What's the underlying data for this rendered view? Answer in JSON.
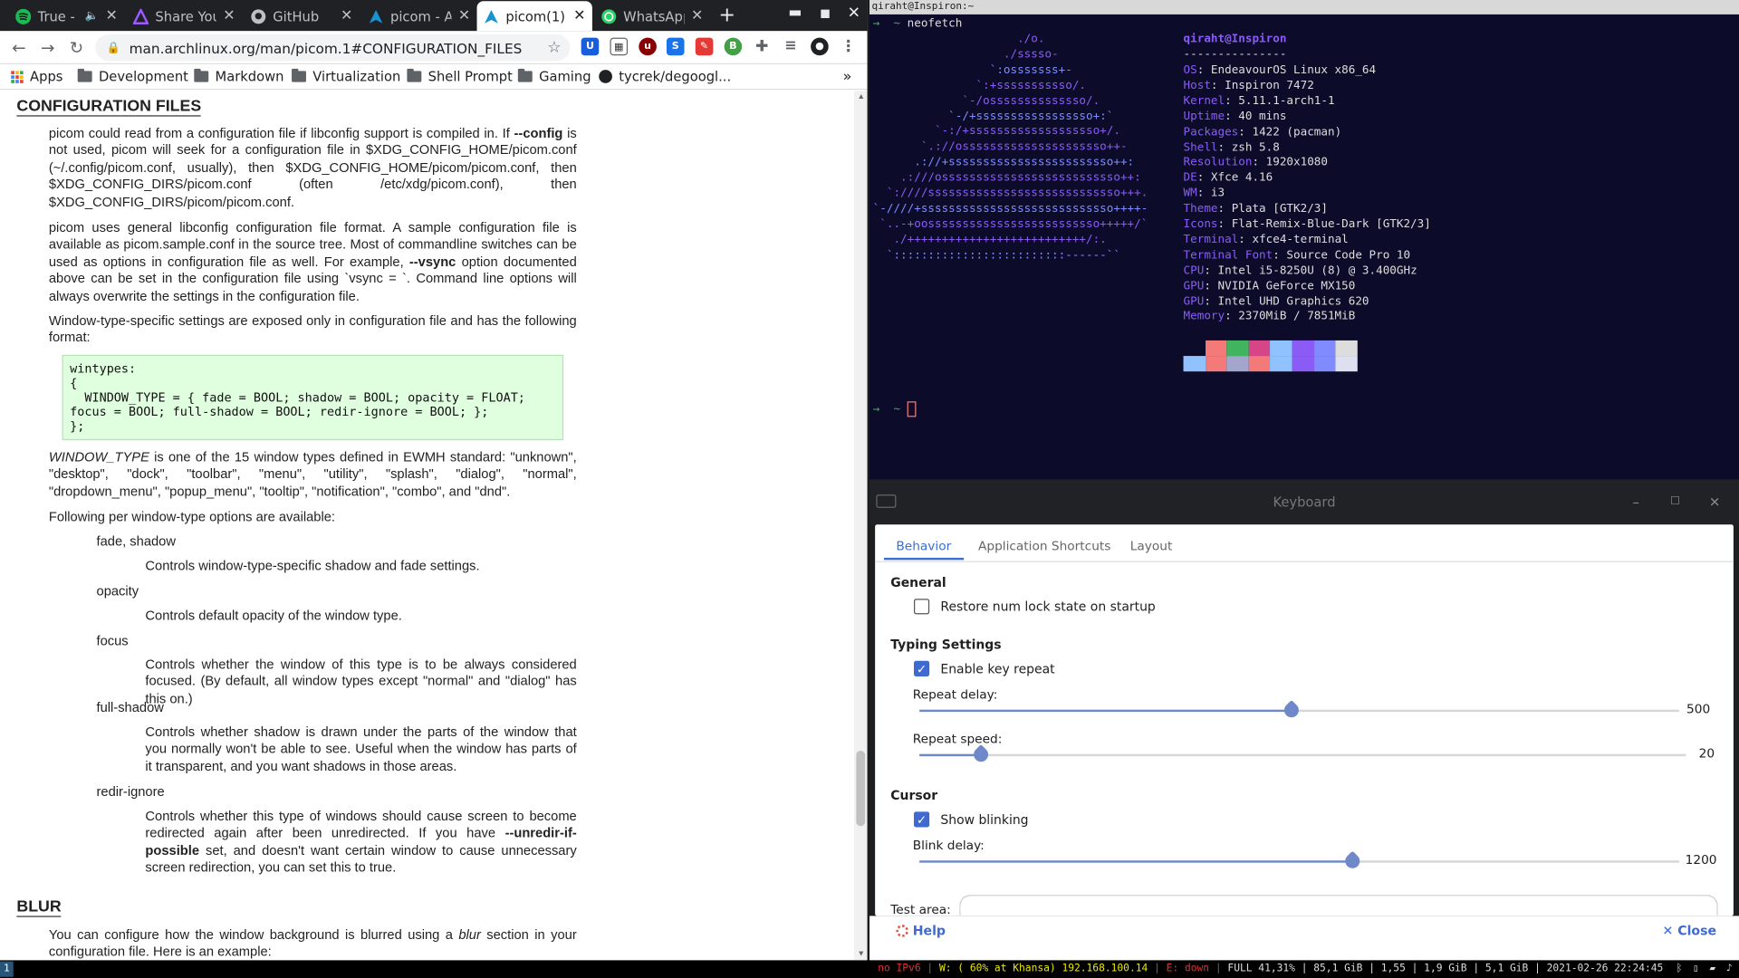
{
  "browser": {
    "tabs": [
      {
        "label": "True -",
        "icon": "spotify-icon",
        "color": "#1db954"
      },
      {
        "label": "Share You",
        "icon": "triangle-icon",
        "color": "#9b59ff"
      },
      {
        "label": "GitHub",
        "icon": "github-icon",
        "color": "#bdc1c6"
      },
      {
        "label": "picom - A",
        "icon": "arch-icon",
        "color": "#1793d1"
      },
      {
        "label": "picom(1)",
        "icon": "arch-icon",
        "color": "#1793d1"
      },
      {
        "label": "WhatsApp",
        "icon": "whatsapp-icon",
        "color": "#25d366"
      }
    ],
    "new_tab": "+",
    "url": "man.archlinux.org/man/picom.1#CONFIGURATION_FILES",
    "bookmarks": [
      "Apps",
      "Development",
      "Markdown",
      "Virtualization",
      "Shell Prompt",
      "Gaming",
      "tycrek/degoogl..."
    ],
    "bookmarks_more": "»"
  },
  "manpage": {
    "h_config": "CONFIGURATION FILES",
    "p1_a": "picom could read from a configuration file if libconfig support is compiled in. If ",
    "p1_b": "--config",
    "p1_c": " is not used, picom will seek for a configuration file in $XDG_CONFIG_HOME/picom.conf (~/.config/picom.conf, usually), then $XDG_CONFIG_HOME/picom/picom.conf, then $XDG_CONFIG_DIRS/picom.conf (often /etc/xdg/picom.conf), then $XDG_CONFIG_DIRS/picom/picom.conf.",
    "p2_a": "picom uses general libconfig configuration file format. A sample configuration file is available as picom.sample.conf in the source tree. Most of commandline switches can be used as options in configuration file as well. For example, ",
    "p2_b": "--vsync",
    "p2_c": " option documented above can be set in the configuration file using `vsync = `. Command line options will always overwrite the settings in the configuration file.",
    "p3": "Window-type-specific settings are exposed only in configuration file and has the following format:",
    "code": "wintypes:\n{\n  WINDOW_TYPE = { fade = BOOL; shadow = BOOL; opacity = FLOAT;\nfocus = BOOL; full-shadow = BOOL; redir-ignore = BOOL; };\n};",
    "p4_a": "WINDOW_TYPE",
    "p4_b": " is one of the 15 window types defined in EWMH standard: \"unknown\", \"desktop\", \"dock\", \"toolbar\", \"menu\", \"utility\", \"splash\", \"dialog\", \"normal\", \"dropdown_menu\", \"popup_menu\", \"tooltip\", \"notification\", \"combo\", and \"dnd\".",
    "p5": "Following per window-type options are available:",
    "opts": [
      {
        "term": "fade, shadow",
        "def": "Controls window-type-specific shadow and fade settings."
      },
      {
        "term": "opacity",
        "def": "Controls default opacity of the window type."
      },
      {
        "term": "focus",
        "def": "Controls whether the window of this type is to be always considered focused. (By default, all window types except \"normal\" and \"dialog\" has this on.)"
      },
      {
        "term": "full-shadow",
        "def": "Controls whether shadow is drawn under the parts of the window that you normally won't be able to see. Useful when the window has parts of it transparent, and you want shadows in those areas."
      }
    ],
    "redir_term": "redir-ignore",
    "redir_a": "Controls whether this type of windows should cause screen to become redirected again after been unredirected. If you have ",
    "redir_b": "--unredir-if-possible",
    "redir_c": " set, and doesn't want certain window to cause unnecessary screen redirection, you can set this to true.",
    "h_blur": "BLUR",
    "blur_a": "You can configure how the window background is blurred using a ",
    "blur_b": "blur",
    "blur_c": " section in your configuration file. Here is an example:"
  },
  "terminal": {
    "title": "qiraht@Inspiron:~",
    "prompt": "→  ~ ",
    "command": "neofetch",
    "logo": [
      "                     ./o.",
      "                   ./sssso-",
      "                 `:osssssss+-",
      "               `:+sssssssssso/.",
      "             `-/ossssssssssssso/.",
      "           `-/+sssssssssssssssso+:`",
      "         `-:/+sssssssssssssssssso+/.",
      "       `.://osssssssssssssssssssso++-",
      "      .://+ssssssssssssssssssssssso++:",
      "    .:///ossssssssssssssssssssssssso++:",
      "  `:////ssssssssssssssssssssssssssso+++.",
      "`-////+ssssssssssssssssssssssssssso++++-",
      " `..-+oosssssssssssssssssssssssso+++++/`",
      "   ./++++++++++++++++++++++++++/:.",
      "  `:::::::::::::::::::::::::------``"
    ],
    "user": "qiraht@Inspiron",
    "sep": "---------------",
    "info": [
      {
        "k": "OS",
        "v": "EndeavourOS Linux x86_64"
      },
      {
        "k": "Host",
        "v": "Inspiron 7472"
      },
      {
        "k": "Kernel",
        "v": "5.11.1-arch1-1"
      },
      {
        "k": "Uptime",
        "v": "40 mins"
      },
      {
        "k": "Packages",
        "v": "1422 (pacman)"
      },
      {
        "k": "Shell",
        "v": "zsh 5.8"
      },
      {
        "k": "Resolution",
        "v": "1920x1080"
      },
      {
        "k": "DE",
        "v": "Xfce 4.16"
      },
      {
        "k": "WM",
        "v": "i3"
      },
      {
        "k": "Theme",
        "v": "Plata [GTK2/3]"
      },
      {
        "k": "Icons",
        "v": "Flat-Remix-Blue-Dark [GTK2/3]"
      },
      {
        "k": "Terminal",
        "v": "xfce4-terminal"
      },
      {
        "k": "Terminal Font",
        "v": "Source Code Pro 10"
      },
      {
        "k": "CPU",
        "v": "Intel i5-8250U (8) @ 3.400GHz"
      },
      {
        "k": "GPU",
        "v": "NVIDIA GeForce MX150"
      },
      {
        "k": "GPU",
        "v": "Intel UHD Graphics 620"
      },
      {
        "k": "Memory",
        "v": "2370MiB / 7851MiB"
      }
    ],
    "palette_top": [
      "#0c0c2a",
      "#f47a7a",
      "#42b35f",
      "#d64587",
      "#8fc2ff",
      "#8a5cf5",
      "#7f8bff",
      "#dddddd"
    ],
    "palette_bottom": [
      "#8fc2ff",
      "#f47a7a",
      "#a2a6cc",
      "#f47a7a",
      "#8fc2ff",
      "#8a5cf5",
      "#7f8bff",
      "#dde0f0"
    ]
  },
  "keyboard": {
    "title": "Keyboard",
    "tabs": [
      "Behavior",
      "Application Shortcuts",
      "Layout"
    ],
    "general": "General",
    "numlock": "Restore num lock state on startup",
    "typing": "Typing Settings",
    "key_repeat": "Enable key repeat",
    "repeat_delay_label": "Repeat delay:",
    "repeat_delay": "500",
    "repeat_delay_level": 0.49,
    "repeat_speed_label": "Repeat speed:",
    "repeat_speed": "20",
    "repeat_speed_level": 0.08,
    "cursor": "Cursor",
    "blinking": "Show blinking",
    "blink_delay_label": "Blink delay:",
    "blink_delay": "1200",
    "blink_delay_level": 0.57,
    "test_area": "Test area:",
    "help": "Help",
    "close": "Close",
    "accent": "#3e6ad1"
  },
  "bar": {
    "workspace": "1",
    "ipv6": "no IPv6",
    "wifi": "W: ( 60% at Khansa) 192.168.100.14",
    "eth": "E: down",
    "rest": "FULL 41,31% | 85,1 GiB | 1,55 | 1,9 GiB | 5,1 GiB | 2021-02-26 22:24:45"
  }
}
